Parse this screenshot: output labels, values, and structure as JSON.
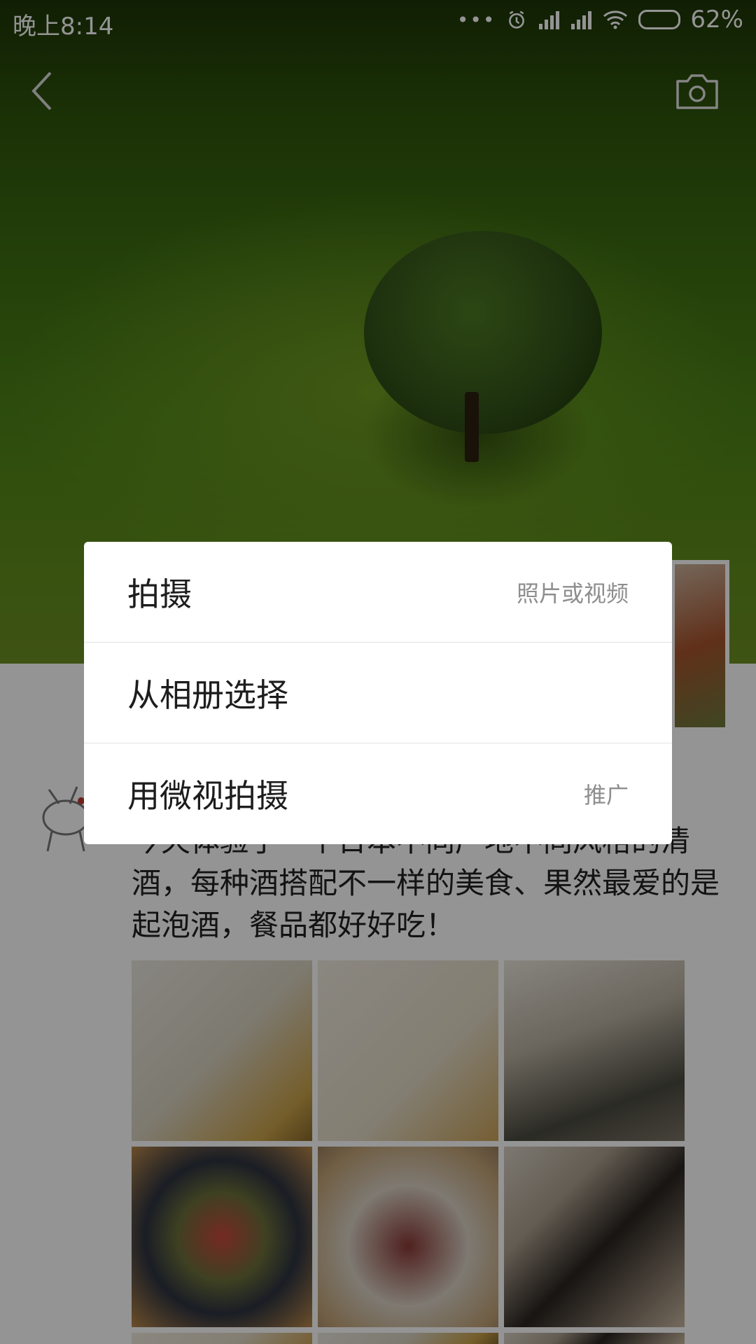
{
  "status_bar": {
    "time": "晚上8:14",
    "battery": "62%",
    "battery_level": 0.62
  },
  "cover_header": {
    "back_icon": "chevron-left-icon",
    "camera_icon": "camera-icon"
  },
  "post": {
    "text": "今天体验了一个日本不同产地不同风格的清酒，每种酒搭配不一样的美食、果然最爱的是起泡酒，餐品都好好吃！"
  },
  "action_sheet": {
    "items": [
      {
        "label": "拍摄",
        "hint": "照片或视频"
      },
      {
        "label": "从相册选择",
        "hint": ""
      },
      {
        "label": "用微视拍摄",
        "hint": "推广"
      }
    ]
  },
  "colors": {
    "scrim": "#000000",
    "sheet_bg": "#ffffff",
    "divider": "#e2e2e2",
    "hint_text": "#8e8e8e"
  }
}
